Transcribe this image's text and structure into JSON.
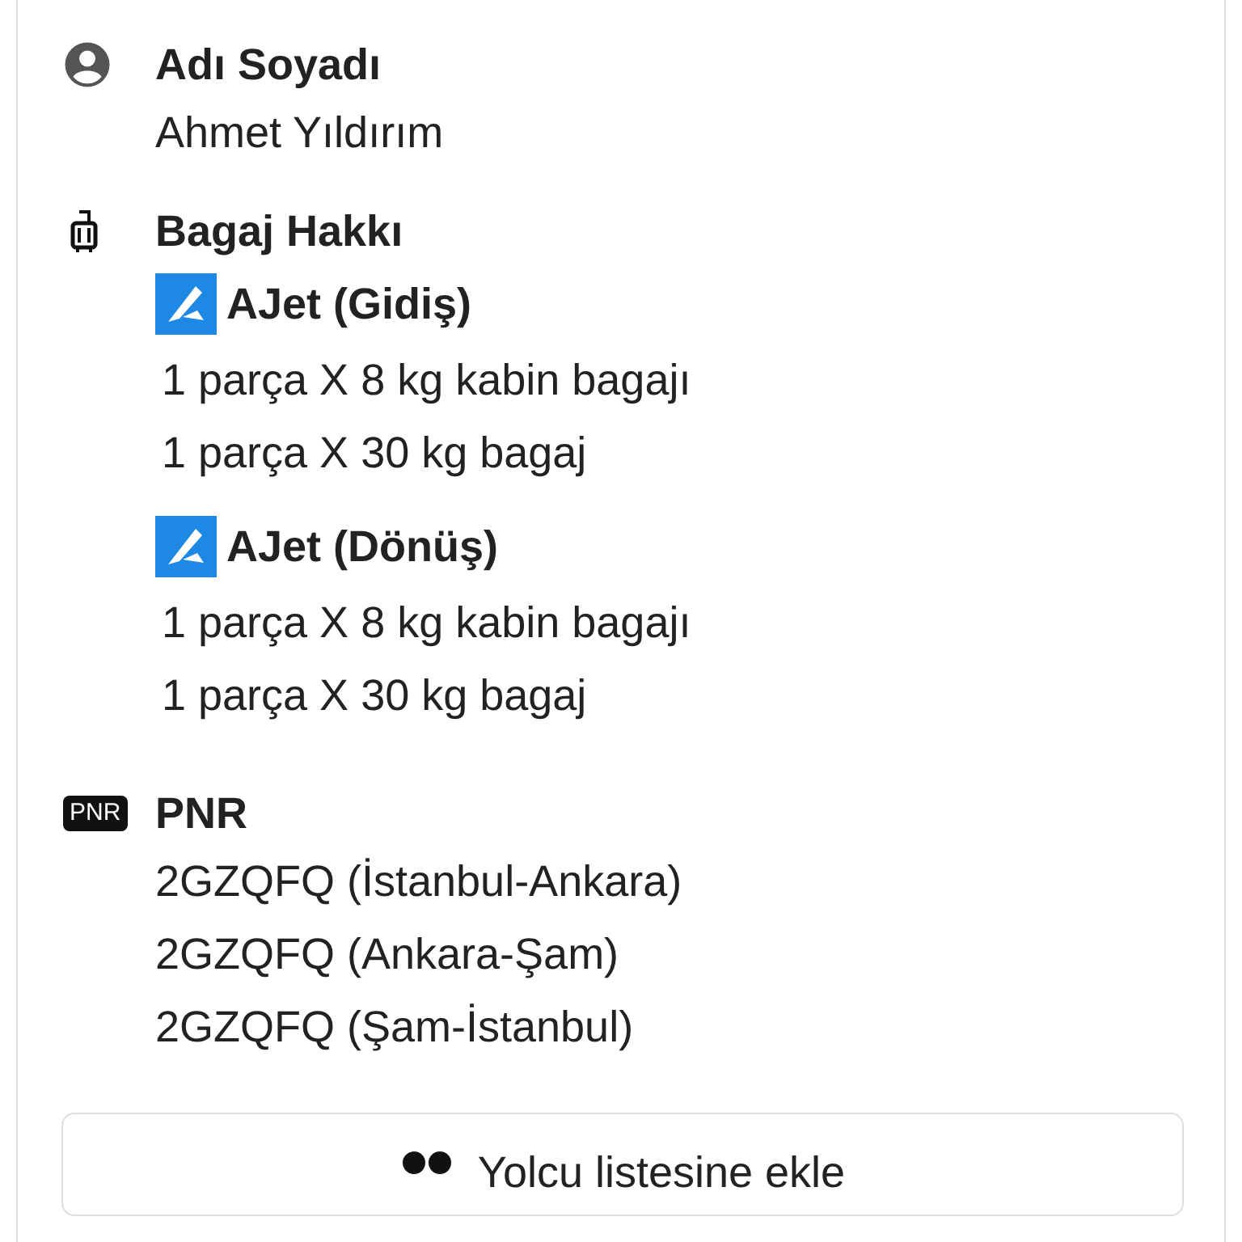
{
  "passenger": {
    "name_label": "Adı Soyadı",
    "name": "Ahmet Yıldırım"
  },
  "baggage": {
    "label": "Bagaj Hakkı",
    "flights": [
      {
        "airline": "AJet (Gidiş)",
        "items": [
          "1 parça X 8 kg kabin bagajı",
          "1 parça X 30 kg bagaj"
        ]
      },
      {
        "airline": "AJet (Dönüş)",
        "items": [
          "1 parça X 8 kg kabin bagajı",
          "1 parça X 30 kg bagaj"
        ]
      }
    ]
  },
  "pnr": {
    "badge": "PNR",
    "label": "PNR",
    "codes": [
      "2GZQFQ (İstanbul-Ankara)",
      "2GZQFQ (Ankara-Şam)",
      "2GZQFQ (Şam-İstanbul)"
    ]
  },
  "add_button": {
    "label": "Yolcu listesine ekle"
  }
}
